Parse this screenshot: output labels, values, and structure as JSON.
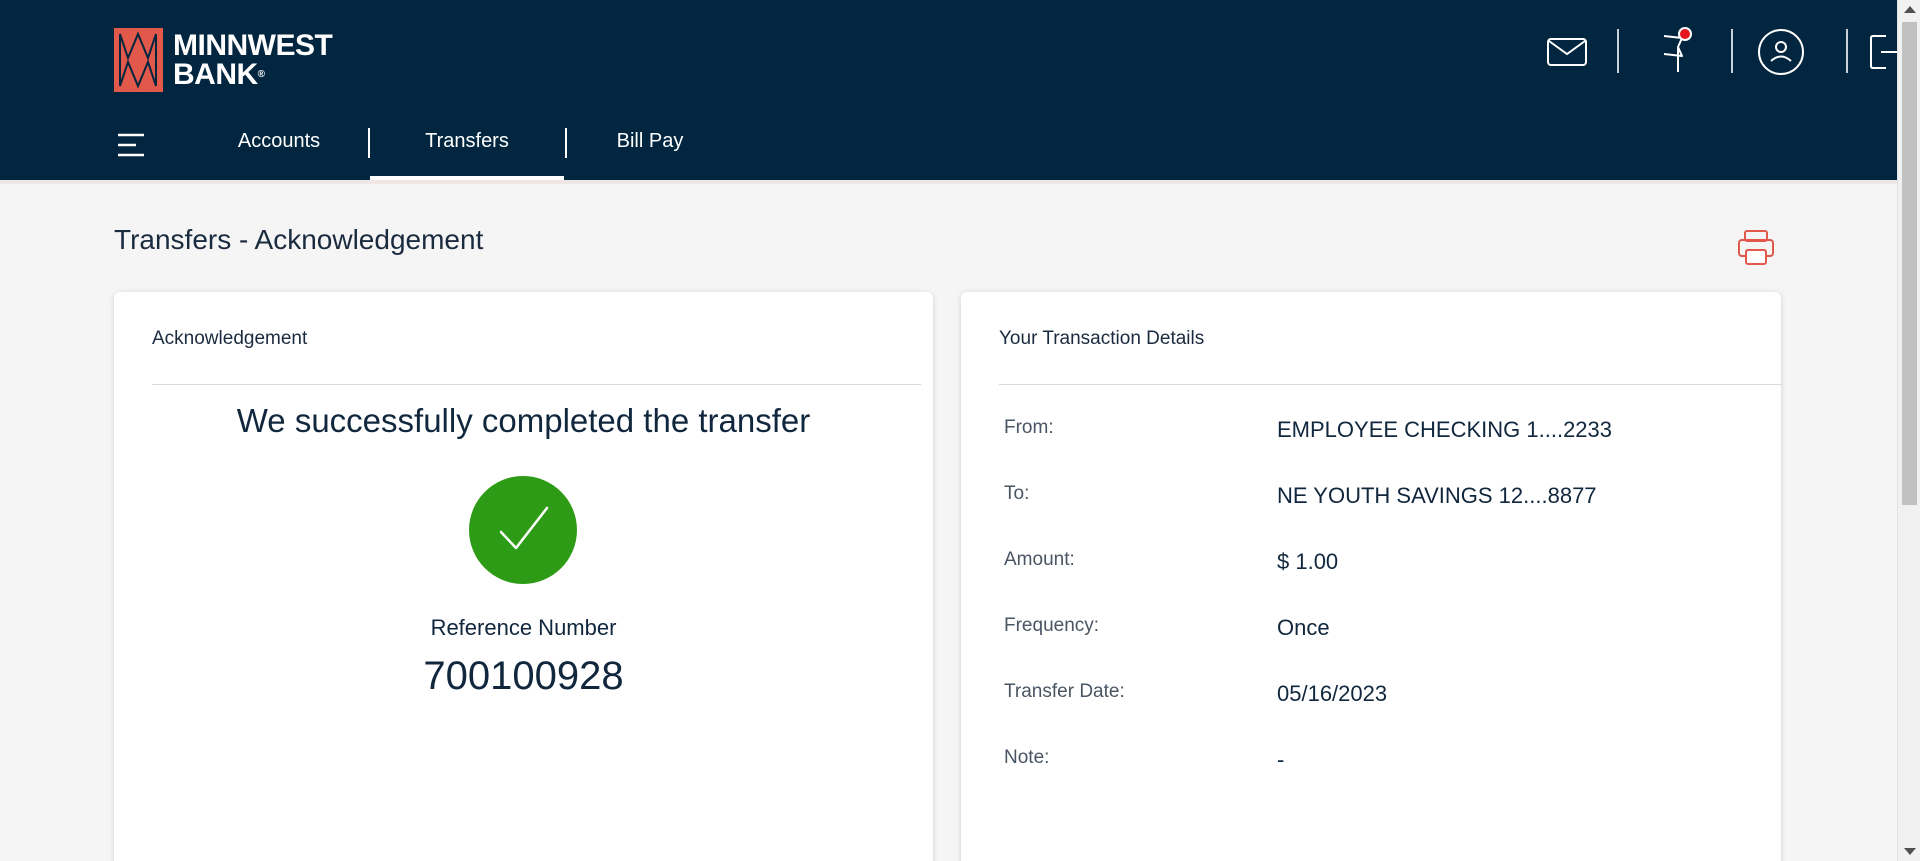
{
  "brand": {
    "name_line1": "MINNWEST",
    "name_line2": "BANK",
    "registered_mark": "®",
    "logo_color": "#e2584a",
    "header_bg": "#02263f"
  },
  "header_icons": [
    {
      "name": "mail-icon"
    },
    {
      "name": "flag-icon",
      "has_badge": true
    },
    {
      "name": "profile-icon"
    },
    {
      "name": "logout-icon"
    }
  ],
  "nav": {
    "items": [
      {
        "label": "Accounts",
        "active": false
      },
      {
        "label": "Transfers",
        "active": true
      },
      {
        "label": "Bill Pay",
        "active": false
      }
    ]
  },
  "page": {
    "title": "Transfers - Acknowledgement"
  },
  "acknowledgement": {
    "heading": "Acknowledgement",
    "message": "We successfully completed the transfer",
    "reference_label": "Reference Number",
    "reference_number": "700100928",
    "success_color": "#2e9b16"
  },
  "details": {
    "heading": "Your Transaction Details",
    "rows": [
      {
        "label": "From:",
        "value": "EMPLOYEE CHECKING 1....2233"
      },
      {
        "label": "To:",
        "value": "NE YOUTH SAVINGS 12....8877"
      },
      {
        "label": "Amount:",
        "value": "$ 1.00"
      },
      {
        "label": "Frequency:",
        "value": "Once"
      },
      {
        "label": "Transfer Date:",
        "value": "05/16/2023"
      },
      {
        "label": "Note:",
        "value": "-"
      }
    ]
  }
}
